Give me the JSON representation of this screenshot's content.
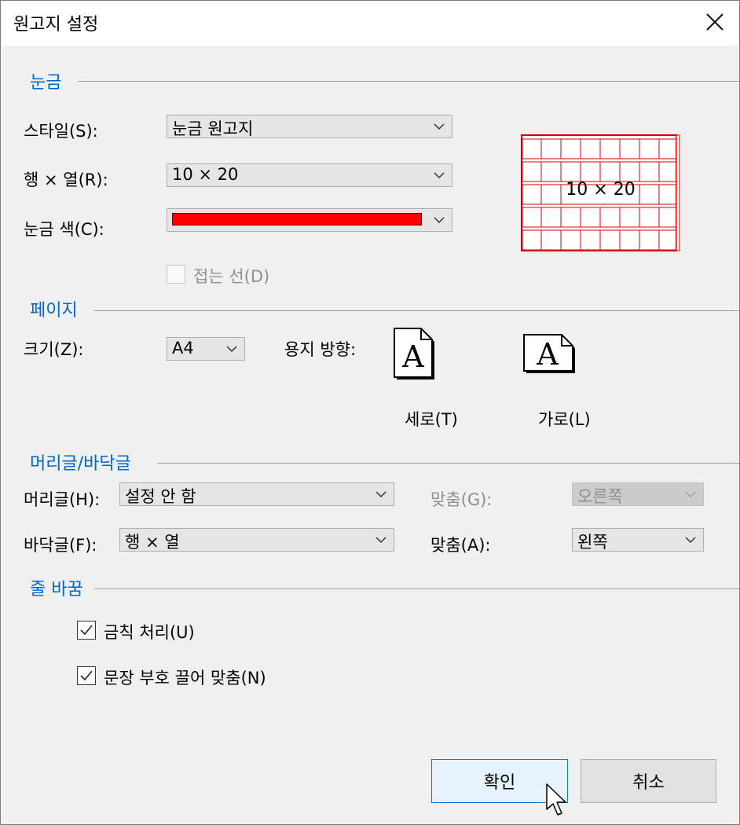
{
  "window": {
    "title": "원고지 설정"
  },
  "grid_section": {
    "title": "눈금",
    "style_label": "스타일(S):",
    "style_value": "눈금 원고지",
    "rowcol_label": "행 × 열(R):",
    "rowcol_value": "10 × 20",
    "color_label": "눈금 색(C):",
    "grid_color": "#ff0000",
    "fold_line_label": "접는 선(D)",
    "fold_line_checked": false,
    "preview_text": "10 × 20"
  },
  "page_section": {
    "title": "페이지",
    "size_label": "크기(Z):",
    "size_value": "A4",
    "orientation_label": "용지 방향:",
    "portrait_label": "세로(T)",
    "landscape_label": "가로(L)",
    "orientation_icon_glyph": "A"
  },
  "header_footer_section": {
    "title": "머리글/바닥글",
    "header_label": "머리글(H):",
    "header_value": "설정 안 함",
    "header_align_label": "맞춤(G):",
    "header_align_value": "오른쪽",
    "footer_label": "바닥글(F):",
    "footer_value": "행 × 열",
    "footer_align_label": "맞춤(A):",
    "footer_align_value": "왼쪽"
  },
  "wrap_section": {
    "title": "줄 바꿈",
    "kinsoku_label": "금칙 처리(U)",
    "kinsoku_checked": true,
    "punct_label": "문장 부호 끌어 맞춤(N)",
    "punct_checked": true
  },
  "buttons": {
    "ok": "확인",
    "cancel": "취소"
  },
  "colors": {
    "accent": "#0066cc",
    "ok_border": "#0078d7"
  }
}
